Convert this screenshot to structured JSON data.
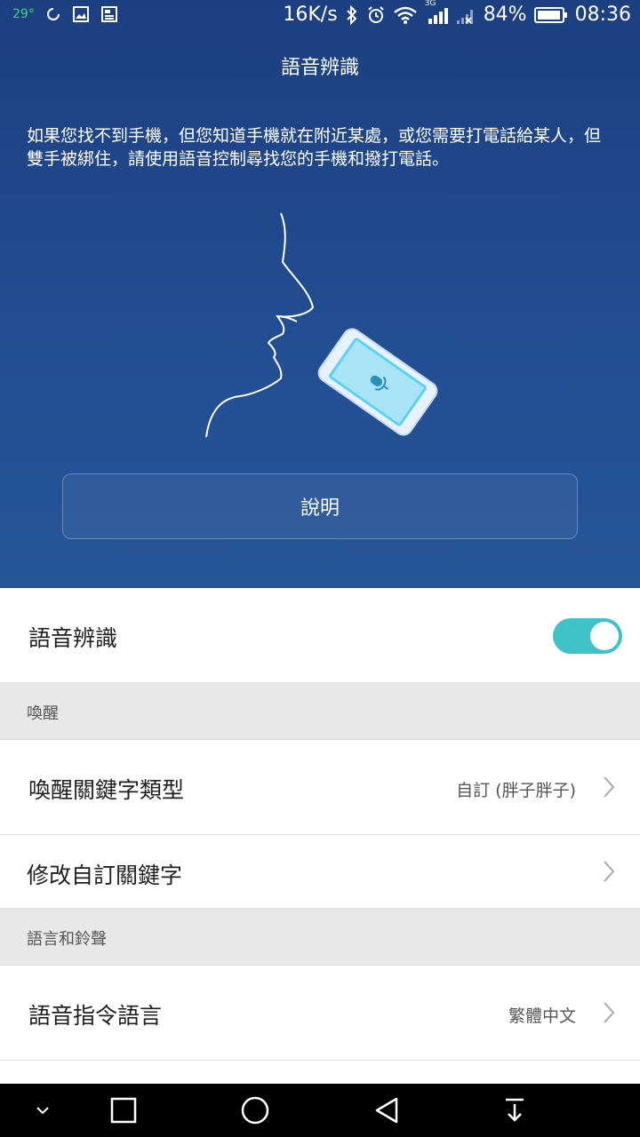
{
  "status_bar": {
    "temperature": "29°",
    "network_speed": "16K/s",
    "network_type": "3G",
    "battery": "84%",
    "time": "08:36"
  },
  "hero": {
    "title": "語音辨識",
    "description": "如果您找不到手機，但您知道手機就在附近某處，或您需要打電話給某人，但雙手被綁住，請使用語音控制尋找您的手機和撥打電話。",
    "help_button": "說明"
  },
  "settings": {
    "voice_recognition": {
      "label": "語音辨識",
      "enabled": true
    },
    "section_wakeup": "喚醒",
    "wakeup_keyword_type": {
      "label": "喚醒關鍵字類型",
      "value": "自訂 (胖子胖子)"
    },
    "edit_custom_keyword": {
      "label": "修改自訂關鍵字"
    },
    "section_language": "語言和鈴聲",
    "command_language": {
      "label": "語音指令語言",
      "value": "繁體中文"
    }
  },
  "colors": {
    "hero_top": "#1c3f80",
    "hero_bottom": "#265598",
    "toggle_on": "#3fc2c8",
    "section_bg": "#e8e8e8"
  }
}
